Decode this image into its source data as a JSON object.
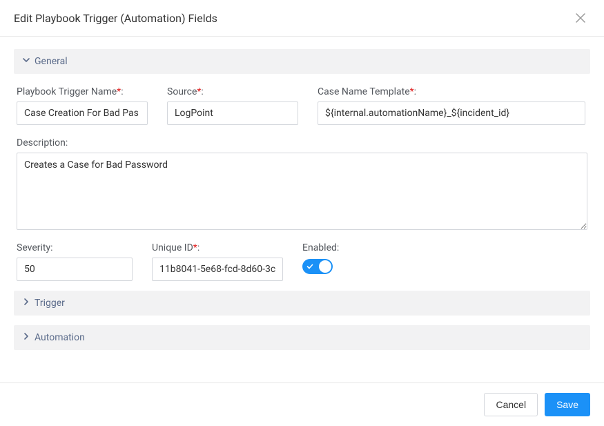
{
  "dialog": {
    "title": "Edit Playbook Trigger (Automation) Fields"
  },
  "sections": {
    "general": {
      "label": "General"
    },
    "trigger": {
      "label": "Trigger"
    },
    "automation": {
      "label": "Automation"
    }
  },
  "fields": {
    "triggerName": {
      "label": "Playbook Trigger Name",
      "value": "Case Creation For Bad Pas"
    },
    "source": {
      "label": "Source",
      "value": "LogPoint"
    },
    "caseNameTemplate": {
      "label": "Case Name Template",
      "value": "${internal.automationName}_${incident_id}"
    },
    "description": {
      "label": "Description:",
      "value": "Creates a Case for Bad Password"
    },
    "severity": {
      "label": "Severity:",
      "value": "50"
    },
    "uniqueId": {
      "label": "Unique ID",
      "value": "11b8041-5e68-fcd-8d60-3c"
    },
    "enabled": {
      "label": "Enabled:",
      "value": true
    }
  },
  "footer": {
    "cancel": "Cancel",
    "save": "Save"
  },
  "punct": {
    "colon": ":",
    "asterisk": "*"
  }
}
